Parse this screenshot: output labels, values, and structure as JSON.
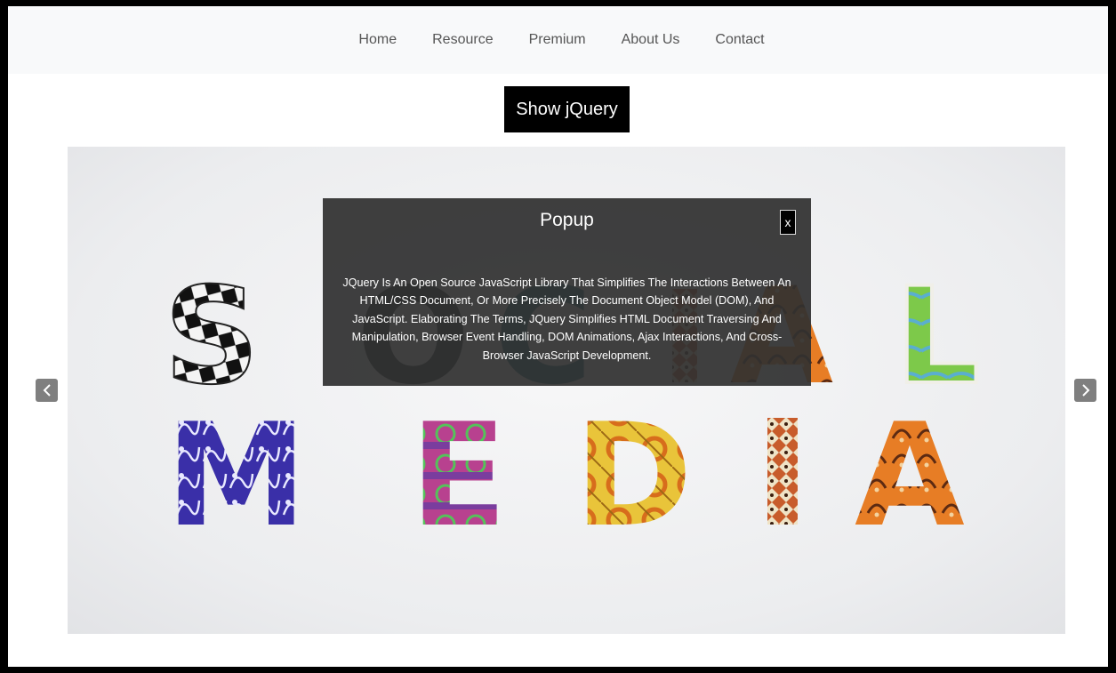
{
  "nav": {
    "items": [
      {
        "label": "Home"
      },
      {
        "label": "Resource"
      },
      {
        "label": "Premium"
      },
      {
        "label": "About Us"
      },
      {
        "label": "Contact"
      }
    ]
  },
  "show_button": {
    "label": "Show jQuery"
  },
  "hero": {
    "image_alt_words": [
      "SOCIAL",
      "MEDIA"
    ],
    "prev_icon": "chevron-left-icon",
    "next_icon": "chevron-right-icon"
  },
  "popup": {
    "title": "Popup",
    "close_label": "x",
    "body": "JQuery Is An Open Source JavaScript Library That Simplifies The Interactions Between An HTML/CSS Document, Or More Precisely The Document Object Model (DOM), And JavaScript. Elaborating The Terms, JQuery Simplifies HTML Document Traversing And Manipulation, Browser Event Handling, DOM Animations, Ajax Interactions, And Cross-Browser JavaScript Development."
  },
  "colors": {
    "navbar_bg": "#f8f9fa",
    "button_bg": "#000000",
    "popup_bg": "#303030",
    "arrow_bg": "#7f7f7f"
  }
}
